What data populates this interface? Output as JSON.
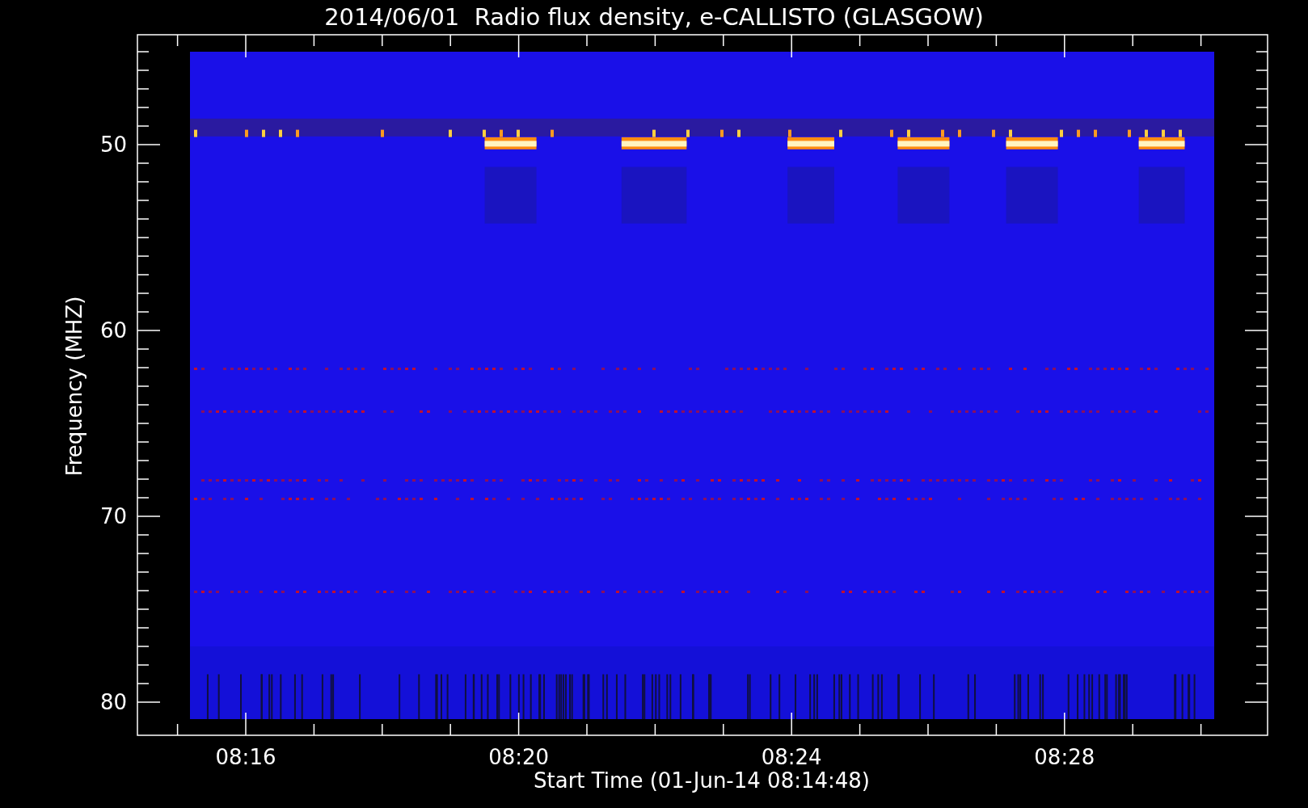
{
  "title": "2014/06/01  Radio flux density, e-CALLISTO (GLASGOW)",
  "y_axis": {
    "label": "Frequency (MHZ)",
    "ticks": [
      "50",
      "60",
      "70",
      "80"
    ]
  },
  "x_axis": {
    "label": "Start Time (01-Jun-14 08:14:48)",
    "ticks": [
      "08:16",
      "08:20",
      "08:24",
      "08:28"
    ]
  }
}
